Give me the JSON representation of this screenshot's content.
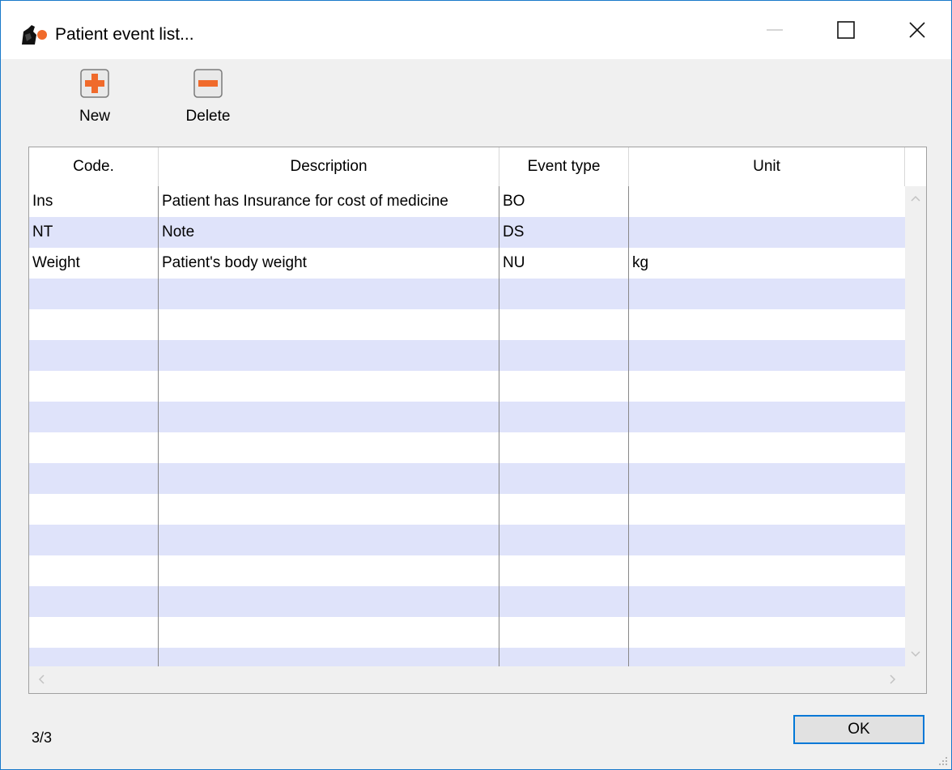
{
  "window": {
    "title": "Patient event list..."
  },
  "toolbar": {
    "new_label": "New",
    "delete_label": "Delete"
  },
  "table": {
    "headers": [
      "Code.",
      "Description",
      "Event type",
      "Unit"
    ],
    "rows": [
      {
        "code": "Ins",
        "description": "Patient has Insurance for cost of medicine",
        "event_type": "BO",
        "unit": ""
      },
      {
        "code": "NT",
        "description": "Note",
        "event_type": "DS",
        "unit": ""
      },
      {
        "code": "Weight",
        "description": "Patient's body weight",
        "event_type": "NU",
        "unit": "kg"
      }
    ]
  },
  "footer": {
    "status": "3/3",
    "ok_label": "OK"
  },
  "colors": {
    "accent": "#0078d7",
    "row_alt": "#dfe3fa",
    "icon_orange": "#f06a2b"
  },
  "icons": [
    "app-icon",
    "minimize-icon",
    "maximize-icon",
    "close-icon",
    "add-icon",
    "remove-icon",
    "scroll-up-icon",
    "scroll-down-icon",
    "scroll-left-icon",
    "scroll-right-icon",
    "resize-grip-icon"
  ]
}
